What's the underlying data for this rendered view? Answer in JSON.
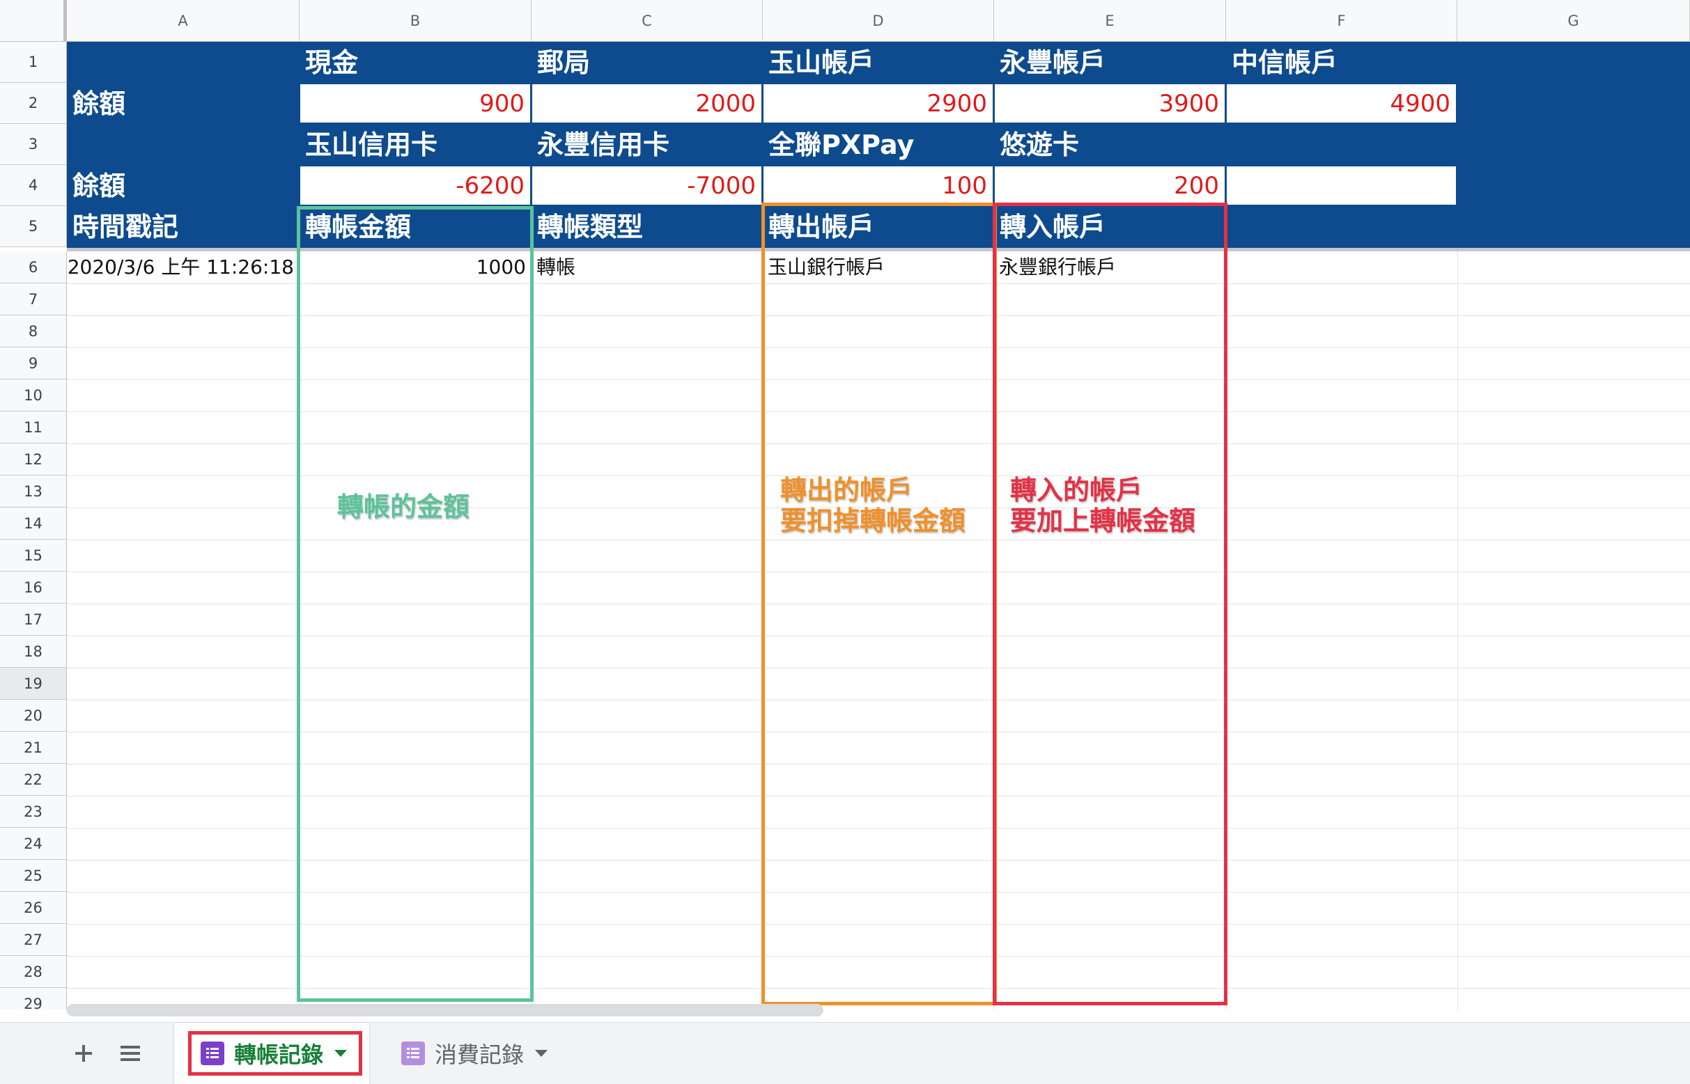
{
  "columns": [
    "A",
    "B",
    "C",
    "D",
    "E",
    "F",
    "G"
  ],
  "rows": [
    "1",
    "2",
    "3",
    "4",
    "5",
    "6",
    "7",
    "8",
    "9",
    "10",
    "11",
    "12",
    "13",
    "14",
    "15",
    "16",
    "17",
    "18",
    "19",
    "20",
    "21",
    "22",
    "23",
    "24",
    "25",
    "26",
    "27",
    "28",
    "29"
  ],
  "selected_row": "19",
  "balances": {
    "row1_names": [
      "現金",
      "郵局",
      "玉山帳戶",
      "永豐帳戶",
      "中信帳戶"
    ],
    "row2_label": "餘額",
    "row2_values": [
      "900",
      "2000",
      "2900",
      "3900",
      "4900"
    ],
    "row3_names": [
      "玉山信用卡",
      "永豐信用卡",
      "全聯PXPay",
      "悠遊卡"
    ],
    "row4_label": "餘額",
    "row4_values": [
      "-6200",
      "-7000",
      "100",
      "200"
    ]
  },
  "record_headers": [
    "時間戳記",
    "轉帳金額",
    "轉帳類型",
    "轉出帳戶",
    "轉入帳戶"
  ],
  "records": [
    {
      "timestamp": "2020/3/6 上午 11:26:18",
      "amount": "1000",
      "type": "轉帳",
      "from": "玉山銀行帳戶",
      "to": "永豐銀行帳戶"
    }
  ],
  "annotations": {
    "amount_note": "轉帳的金額",
    "from_note_1": "轉出的帳戶",
    "from_note_2": "要扣掉轉帳金額",
    "to_note_1": "轉入的帳戶",
    "to_note_2": "要加上轉帳金額",
    "colors": {
      "green": "#5cc39a",
      "orange": "#f0902a",
      "red": "#e43146"
    }
  },
  "sheet_tabs": [
    {
      "label": "轉帳記錄",
      "active": true
    },
    {
      "label": "消費記錄",
      "active": false
    }
  ],
  "toolbar": {
    "add_sheet_icon": "plus-icon",
    "all_sheets_icon": "list-icon"
  }
}
